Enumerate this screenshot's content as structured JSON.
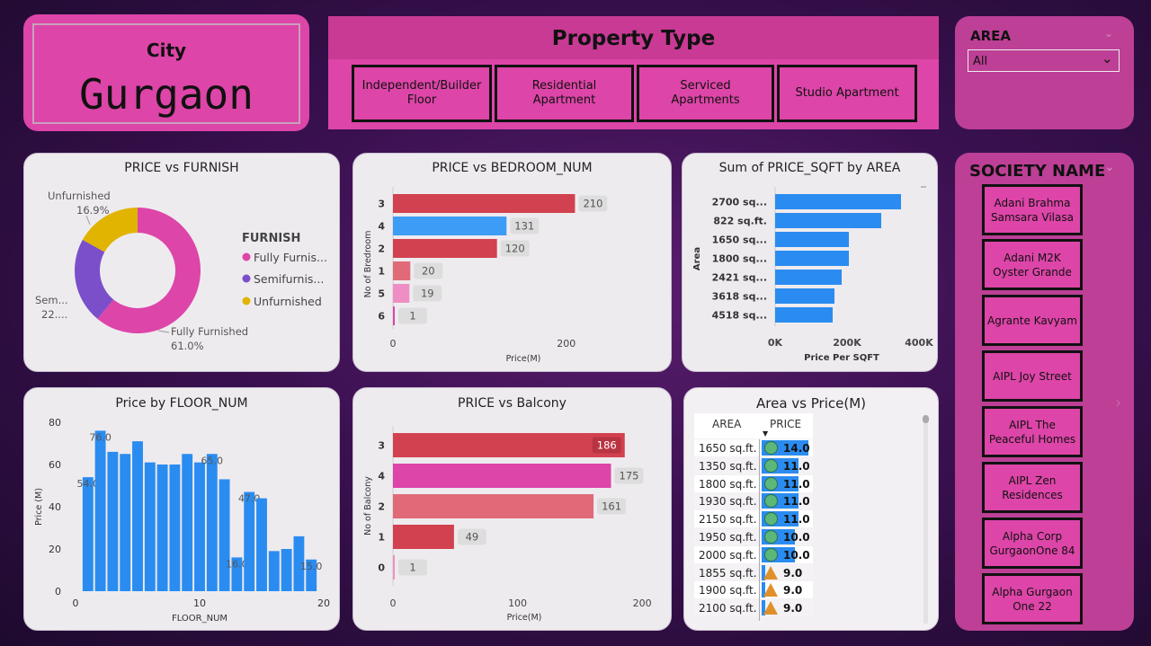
{
  "city": {
    "label": "City",
    "value": "Gurgaon"
  },
  "property_type": {
    "title": "Property Type",
    "options": [
      "Independent/Builder Floor",
      "Residential Apartment",
      "Serviced Apartments",
      "Studio Apartment"
    ]
  },
  "area_filter": {
    "title": "AREA",
    "selected": "All"
  },
  "society": {
    "title": "SOCIETY NAME",
    "items": [
      "Adani Brahma Samsara Vilasa",
      "Adani M2K Oyster Grande",
      "Agrante Kavyam",
      "AIPL Joy Street",
      "AIPL The Peaceful Homes",
      "AIPL Zen Residences",
      "Alpha Corp GurgaonOne 84",
      "Alpha Gurgaon One 22"
    ]
  },
  "colors": {
    "pink": "#dd45a8",
    "blue": "#2a8cf0",
    "red": "#d2414f",
    "purple": "#7b4fc9",
    "gold": "#e0b400"
  },
  "chart_data": [
    {
      "id": "furnish",
      "type": "pie",
      "title": "PRICE vs FURNISH",
      "legend_title": "FURNISH",
      "legend": [
        "Fully Furnis...",
        "Semifurnis...",
        "Unfurnished"
      ],
      "slices": [
        {
          "name": "Fully Furnished",
          "pct": 61.0,
          "color": "#dd45a8",
          "label": "Fully Furnished",
          "pct_label": "61.0%"
        },
        {
          "name": "Semifurnished",
          "pct": 22.1,
          "color": "#7b4fc9",
          "label": "Sem...",
          "pct_label": "22...."
        },
        {
          "name": "Unfurnished",
          "pct": 16.9,
          "color": "#e0b400",
          "label": "Unfurnished",
          "pct_label": "16.9%"
        }
      ]
    },
    {
      "id": "bedroom",
      "type": "bar",
      "title": "PRICE vs BEDROOM_NUM",
      "xlabel": "Price(M)",
      "ylabel": "No of Bredroom",
      "categories": [
        "3",
        "4",
        "2",
        "1",
        "5",
        "6"
      ],
      "values": [
        210,
        131,
        120,
        20,
        19,
        1
      ],
      "colors": [
        "#d2414f",
        "#3d9cf5",
        "#d2414f",
        "#e06a78",
        "#ee8ec4",
        "#dd45a8"
      ],
      "xlim": [
        0,
        250
      ],
      "xticks": [
        0,
        200
      ]
    },
    {
      "id": "sqft",
      "type": "bar",
      "title": "Sum of PRICE_SQFT by AREA",
      "xlabel": "Price Per SQFT",
      "ylabel": "Area",
      "categories": [
        "2700 sq...",
        "822 sq.ft.",
        "1650 sq...",
        "1800 sq...",
        "2421 sq...",
        "3618 sq...",
        "4518 sq..."
      ],
      "values": [
        350000,
        295000,
        205000,
        205000,
        185000,
        165000,
        160000
      ],
      "xlim": [
        0,
        420000
      ],
      "xticks": [
        "0K",
        "200K",
        "400K"
      ]
    },
    {
      "id": "floor",
      "type": "bar",
      "title": "Price by FLOOR_NUM",
      "xlabel": "FLOOR_NUM",
      "ylabel": "Price (M)",
      "x": [
        1,
        2,
        3,
        4,
        5,
        6,
        7,
        8,
        9,
        10,
        11,
        12,
        13,
        14,
        15,
        16,
        17,
        18,
        19
      ],
      "values": [
        54,
        76,
        66,
        65,
        71,
        61,
        60,
        60,
        65,
        61,
        65,
        53,
        16,
        47,
        44,
        19,
        20,
        26,
        15
      ],
      "data_labels": {
        "1": "54.0",
        "2": "76.0",
        "11": "65.0",
        "13": "16.0",
        "14": "47.0",
        "19": "15.0"
      },
      "xlim": [
        0,
        20
      ],
      "ylim": [
        0,
        80
      ],
      "xticks": [
        "0",
        "10",
        "20"
      ],
      "yticks": [
        "0",
        "20",
        "40",
        "60",
        "80"
      ]
    },
    {
      "id": "balcony",
      "type": "bar",
      "title": "PRICE vs Balcony",
      "xlabel": "Price(M)",
      "ylabel": "No of Balcony",
      "categories": [
        "3",
        "4",
        "2",
        "1",
        "0"
      ],
      "values": [
        186,
        175,
        161,
        49,
        1
      ],
      "colors": [
        "#d2414f",
        "#dd45a8",
        "#e06a78",
        "#d2414f",
        "#ee8ec4"
      ],
      "xlim": [
        0,
        210
      ],
      "xticks": [
        "0",
        "100",
        "200"
      ]
    },
    {
      "id": "area_price",
      "type": "table",
      "title": "Area vs Price(M)",
      "columns": [
        "AREA",
        "PRICE"
      ],
      "rows": [
        {
          "area": "1650 sq.ft.",
          "price": "14.0",
          "icon": "circle"
        },
        {
          "area": "1350 sq.ft.",
          "price": "11.0",
          "icon": "circle"
        },
        {
          "area": "1800 sq.ft.",
          "price": "11.0",
          "icon": "circle"
        },
        {
          "area": "1930 sq.ft.",
          "price": "11.0",
          "icon": "circle"
        },
        {
          "area": "2150 sq.ft.",
          "price": "11.0",
          "icon": "circle"
        },
        {
          "area": "1950 sq.ft.",
          "price": "10.0",
          "icon": "circle"
        },
        {
          "area": "2000 sq.ft.",
          "price": "10.0",
          "icon": "circle"
        },
        {
          "area": "1855 sq.ft.",
          "price": "9.0",
          "icon": "triangle"
        },
        {
          "area": "1900 sq.ft.",
          "price": "9.0",
          "icon": "triangle"
        },
        {
          "area": "2100 sq.ft.",
          "price": "9.0",
          "icon": "triangle"
        }
      ]
    }
  ]
}
